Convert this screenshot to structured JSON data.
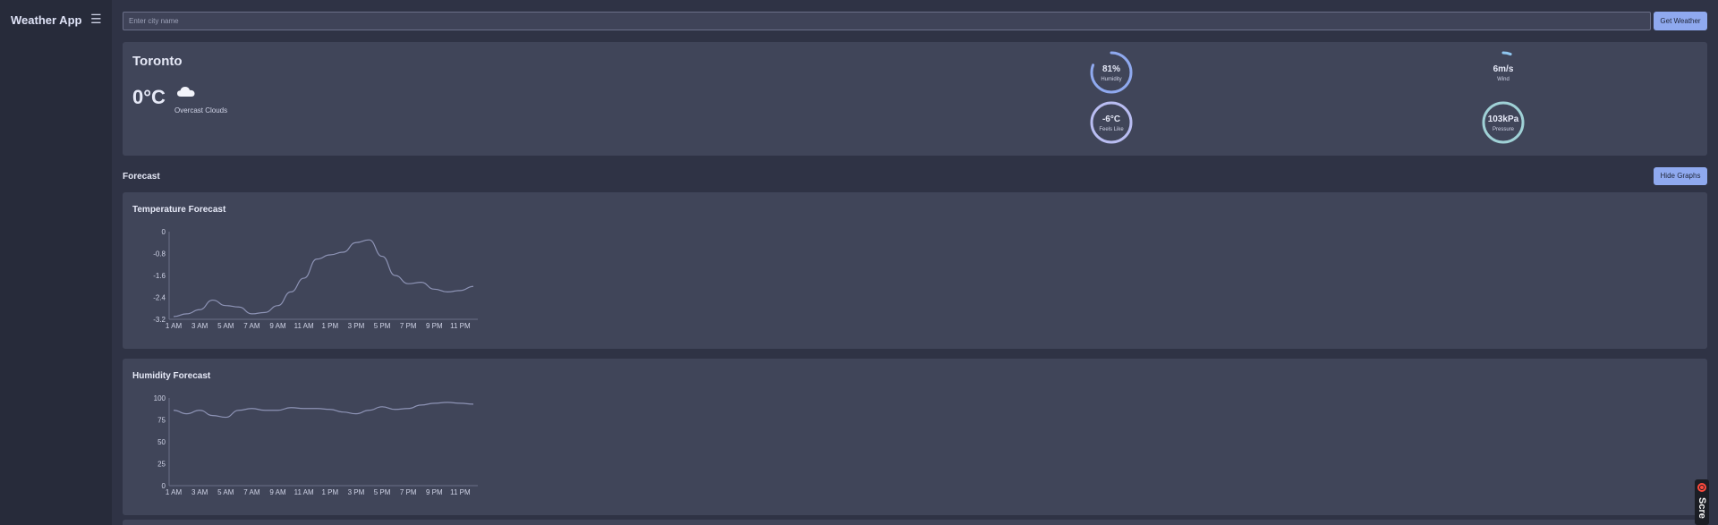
{
  "app": {
    "title": "Weather App",
    "menu_icon": "hamburger-icon"
  },
  "search": {
    "placeholder": "Enter city name",
    "value": "",
    "button_label": "Get Weather"
  },
  "current": {
    "city": "Toronto",
    "temperature": "0°C",
    "condition": "Overcast Clouds",
    "condition_icon": "cloud-icon",
    "metrics": [
      {
        "value": "81%",
        "label": "Humidity",
        "fraction": 0.81,
        "color": "#8fa9ef"
      },
      {
        "value": "6m/s",
        "label": "Wind",
        "fraction": 0.06,
        "color": "#8fc6ef"
      },
      {
        "value": "-6°C",
        "label": "Feels Like",
        "fraction": 1.0,
        "color": "#b9bdf2"
      },
      {
        "value": "103kPa",
        "label": "Pressure",
        "fraction": 1.0,
        "color": "#9fd1d6"
      }
    ]
  },
  "forecast": {
    "title": "Forecast",
    "toggle_label": "Hide Graphs"
  },
  "chart_data": [
    {
      "type": "line",
      "title": "Temperature Forecast",
      "xlabel": "",
      "ylabel": "",
      "x_ticks": [
        "1 AM",
        "3 AM",
        "5 AM",
        "7 AM",
        "9 AM",
        "11 AM",
        "1 PM",
        "3 PM",
        "5 PM",
        "7 PM",
        "9 PM",
        "11 PM"
      ],
      "y_ticks": [
        "0",
        "-0.8",
        "-1.6",
        "-2.4",
        "-3.2"
      ],
      "ylim": [
        -3.2,
        0
      ],
      "series": [
        {
          "values": [
            -3.1,
            -3.0,
            -2.85,
            -2.5,
            -2.7,
            -2.75,
            -3.0,
            -2.95,
            -2.7,
            -2.2,
            -1.7,
            -1.0,
            -0.85,
            -0.75,
            -0.4,
            -0.3,
            -0.9,
            -1.6,
            -1.9,
            -1.85,
            -2.1,
            -2.2,
            -2.15,
            -2.0
          ]
        }
      ]
    },
    {
      "type": "line",
      "title": "Humidity Forecast",
      "xlabel": "",
      "ylabel": "",
      "x_ticks": [
        "1 AM",
        "3 AM",
        "5 AM",
        "7 AM",
        "9 AM",
        "11 AM",
        "1 PM",
        "3 PM",
        "5 PM",
        "7 PM",
        "9 PM",
        "11 PM"
      ],
      "y_ticks": [
        "100",
        "75",
        "50",
        "25",
        "0"
      ],
      "ylim": [
        0,
        100
      ],
      "series": [
        {
          "values": [
            86,
            82,
            86,
            80,
            78,
            86,
            88,
            86,
            86,
            89,
            88,
            88,
            87,
            84,
            82,
            86,
            90,
            87,
            88,
            92,
            94,
            95,
            94,
            93
          ]
        }
      ]
    }
  ]
}
